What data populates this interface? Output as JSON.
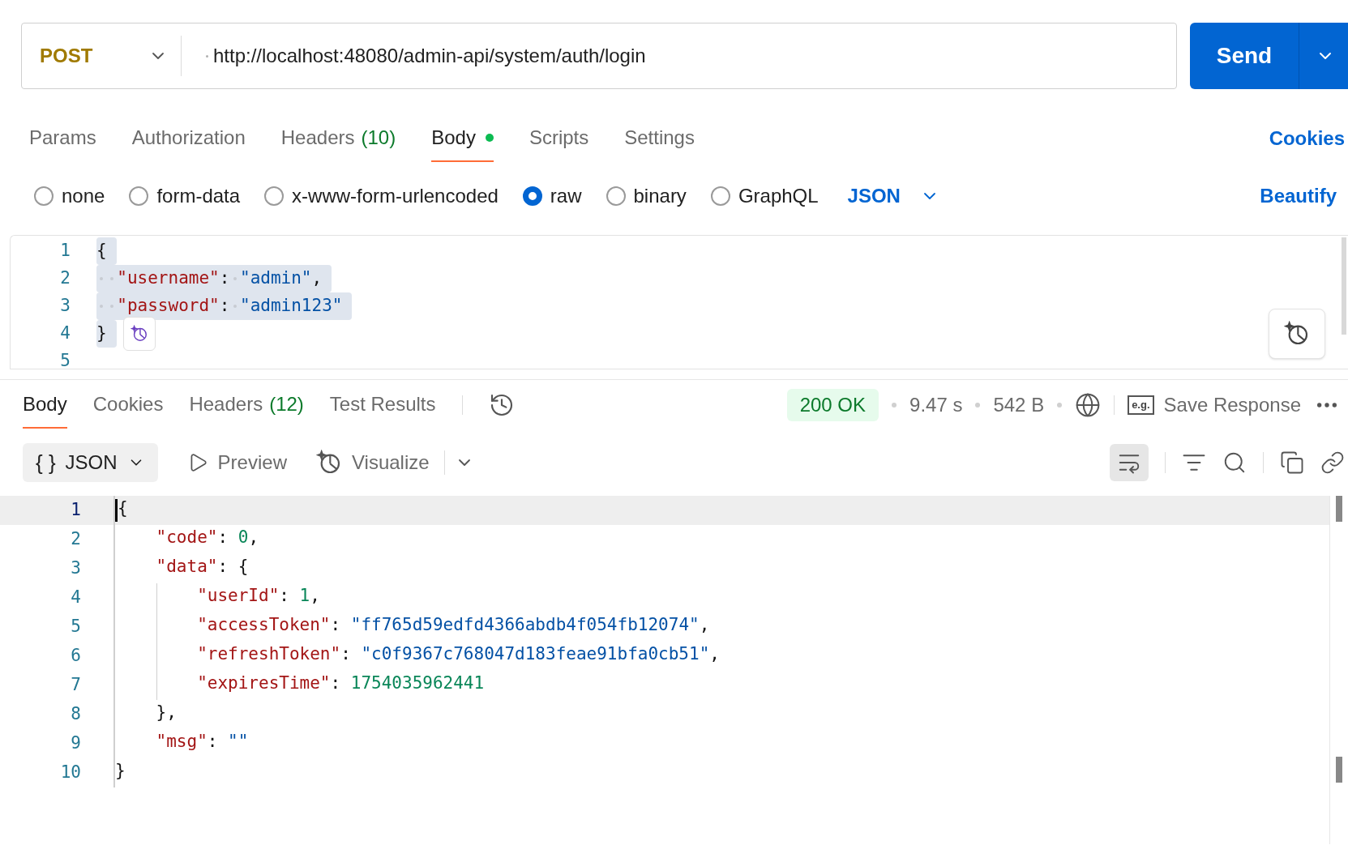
{
  "request": {
    "method": "POST",
    "url": "http://localhost:48080/admin-api/system/auth/login",
    "send": "Send"
  },
  "request_tabs": [
    {
      "label": "Params",
      "selected": false
    },
    {
      "label": "Authorization",
      "selected": false
    },
    {
      "label": "Headers",
      "count": "(10)",
      "selected": false
    },
    {
      "label": "Body",
      "selected": true,
      "dot": true
    },
    {
      "label": "Scripts",
      "selected": false
    },
    {
      "label": "Settings",
      "selected": false
    }
  ],
  "cookies_link": "Cookies",
  "body_types": [
    {
      "label": "none",
      "selected": false
    },
    {
      "label": "form-data",
      "selected": false
    },
    {
      "label": "x-www-form-urlencoded",
      "selected": false
    },
    {
      "label": "raw",
      "selected": true
    },
    {
      "label": "binary",
      "selected": false
    },
    {
      "label": "GraphQL",
      "selected": false
    }
  ],
  "body_format": "JSON",
  "beautify": "Beautify",
  "request_body": [
    {
      "number": "1",
      "code": "{",
      "selected": true
    },
    {
      "number": "2",
      "code": "  \"username\": \"admin\",",
      "selected": true
    },
    {
      "number": "3",
      "code": "  \"password\": \"admin123\"",
      "selected": true
    },
    {
      "number": "4",
      "code": "}",
      "selected": true
    },
    {
      "number": "5"
    }
  ],
  "response_tabs": [
    {
      "label": "Body",
      "selected": true
    },
    {
      "label": "Cookies",
      "selected": false
    },
    {
      "label": "Headers",
      "count": "(12)",
      "selected": false
    },
    {
      "label": "Test Results",
      "selected": false
    }
  ],
  "status": "200 OK",
  "time": "9.47 s",
  "size": "542 B",
  "save_icon_text": "e.g.",
  "save_response": "Save Response",
  "response_format": {
    "icon_text": "{ }",
    "label": "JSON"
  },
  "response_views": [
    {
      "kind": "preview",
      "label": "Preview"
    },
    {
      "kind": "visualize",
      "label": "Visualize"
    }
  ],
  "wrap_lines_on": true,
  "response_body": [
    {
      "number": "1",
      "code": "{",
      "active": true
    },
    {
      "number": "2",
      "code": "    \"code\": 0,",
      "active": false
    },
    {
      "number": "3",
      "code": "    \"data\": {",
      "active": false
    },
    {
      "number": "4",
      "code": "        \"userId\": 1,",
      "active": false
    },
    {
      "number": "5",
      "code": "        \"accessToken\": \"ff765d59edfd4366abdb4f054fb12074\",",
      "active": false
    },
    {
      "number": "6",
      "code": "        \"refreshToken\": \"c0f9367c768047d183feae91bfa0cb51\",",
      "active": false
    },
    {
      "number": "7",
      "code": "        \"expiresTime\": 1754035962441",
      "active": false
    },
    {
      "number": "8",
      "code": "    },",
      "active": false
    },
    {
      "number": "9",
      "code": "    \"msg\": \"\"",
      "active": false
    },
    {
      "number": "10",
      "code": "}",
      "active": false
    }
  ]
}
